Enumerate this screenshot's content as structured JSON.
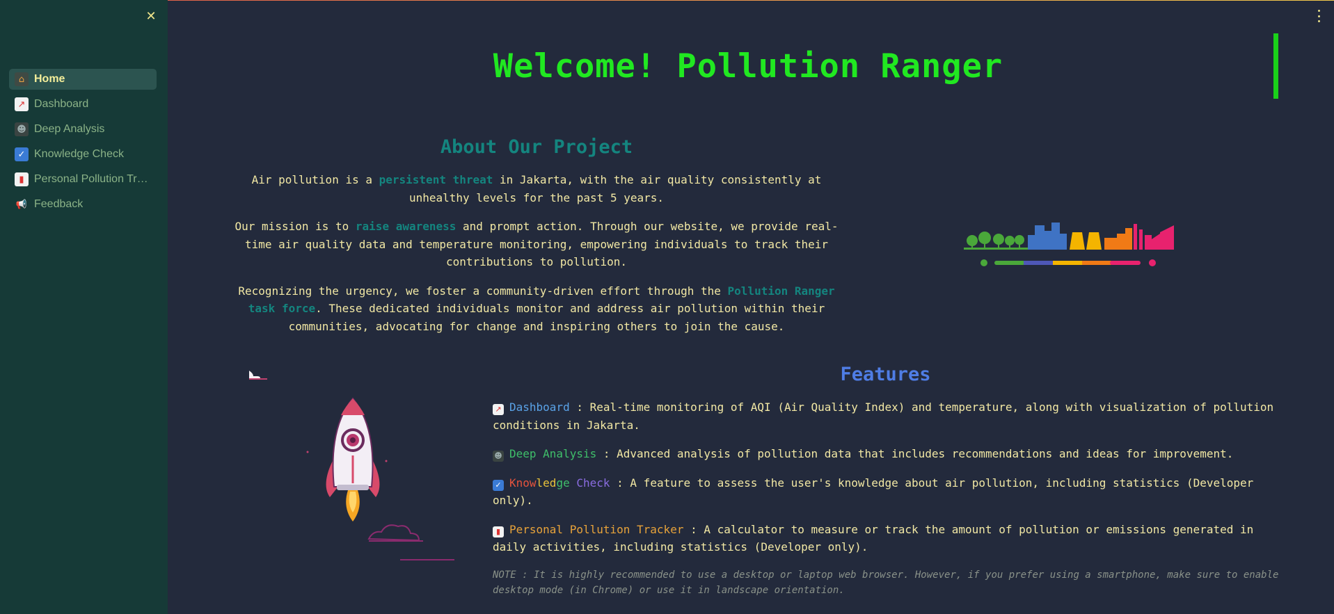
{
  "app": {
    "title": "Welcome! Pollution Ranger"
  },
  "sidebar": {
    "close_icon": "close-icon",
    "items": [
      {
        "label": "Home",
        "icon": "house-icon",
        "active": true
      },
      {
        "label": "Dashboard",
        "icon": "chart-icon",
        "active": false
      },
      {
        "label": "Deep Analysis",
        "icon": "spy-icon",
        "active": false
      },
      {
        "label": "Knowledge Check",
        "icon": "checkbox-icon",
        "active": false
      },
      {
        "label": "Personal Pollution Tracker",
        "icon": "bookmark-icon",
        "active": false
      },
      {
        "label": "Feedback",
        "icon": "megaphone-icon",
        "active": false
      }
    ]
  },
  "about": {
    "title": "About Our Project",
    "p1_a": "Air pollution is a ",
    "p1_hl": "persistent threat",
    "p1_b": " in Jakarta, with the air quality consistently at unhealthy levels for the past 5 years.",
    "p2_a": "Our mission is to ",
    "p2_hl": "raise awareness",
    "p2_b": " and prompt action. Through our website, we provide real-time air quality data and temperature monitoring, empowering individuals to track their contributions to pollution.",
    "p3_a": "Recognizing the urgency, we foster a community-driven effort through the ",
    "p3_hl": "Pollution Ranger task force",
    "p3_b": ". These dedicated individuals monitor and address air pollution within their communities, advocating for change and inspiring others to join the cause."
  },
  "features": {
    "title": "Features",
    "items": [
      {
        "name": "Dashboard",
        "desc": " : Real-time monitoring of AQI (Air Quality Index) and temperature, along with visualization of pollution conditions in Jakarta."
      },
      {
        "name": "Deep Analysis",
        "desc": " : Advanced analysis of pollution data that includes recommendations and ideas for improvement."
      },
      {
        "name_parts": [
          "Know",
          "led",
          "ge ",
          "Check"
        ],
        "desc": " : A feature to assess the user's knowledge about air pollution, including statistics (Developer only)."
      },
      {
        "name": "Personal Pollution Tracker",
        "desc": " : A calculator to measure or track the amount of pollution or emissions generated in daily activities, including statistics (Developer only)."
      }
    ],
    "note": "NOTE : It is highly recommended to use a desktop or laptop web browser. However, if you prefer using a smartphone, make sure to enable desktop mode (in Chrome) or use it in landscape orientation."
  },
  "colors": {
    "title_green": "#21e821",
    "teal": "#14857f",
    "features_blue": "#4f7de5",
    "text_yellow": "#f2e8a4"
  }
}
